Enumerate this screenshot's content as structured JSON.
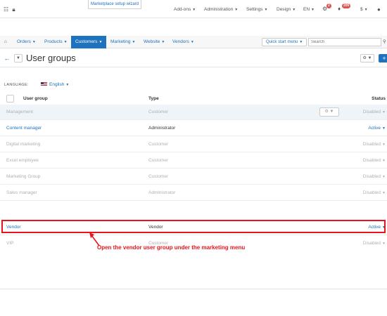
{
  "topbar": {
    "wizard_label": "Marketplace setup wizard",
    "addons": "Add-ons",
    "administration": "Administration",
    "settings": "Settings",
    "design": "Design",
    "lang": "EN",
    "badge_a": "2",
    "badge_b": "205",
    "currency": "$"
  },
  "menu": {
    "orders": "Orders",
    "products": "Products",
    "customers": "Customers",
    "marketing": "Marketing",
    "website": "Website",
    "vendors": "Vendors",
    "quick_start": "Quick start menu",
    "search_placeholder": "Search"
  },
  "page": {
    "title": "User groups",
    "language_label": "LANGUAGE:",
    "language_value": "English"
  },
  "table": {
    "headers": {
      "group": "User group",
      "type": "Type",
      "status": "Status"
    },
    "rows": [
      {
        "name": "Management",
        "type": "Customer",
        "status": "Disabled"
      },
      {
        "name": "Content manager",
        "type": "Administrator",
        "status": "Active"
      },
      {
        "name": "Digital marketing",
        "type": "Customer",
        "status": "Disabled"
      },
      {
        "name": "Excel employee",
        "type": "Customer",
        "status": "Disabled"
      },
      {
        "name": "Marketing Group",
        "type": "Customer",
        "status": "Disabled"
      },
      {
        "name": "Sales manager",
        "type": "Administrator",
        "status": "Disabled"
      },
      {
        "name": "Vendor",
        "type": "Vendor",
        "status": "Active"
      },
      {
        "name": "VIP",
        "type": "Customer",
        "status": "Disabled"
      }
    ]
  },
  "annotation": {
    "text": "Open the vendor user group under the marketing menu",
    "color": "#e8141d"
  },
  "colors": {
    "accent": "#1e73be"
  }
}
